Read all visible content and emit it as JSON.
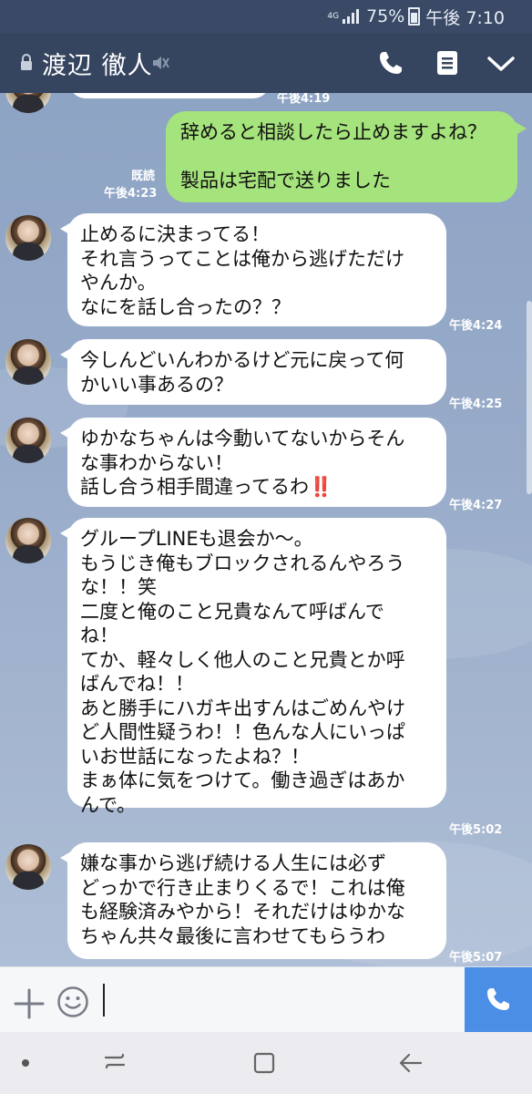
{
  "status_bar": {
    "network": "4G",
    "battery": "75%",
    "time": "午後 7:10"
  },
  "header": {
    "title": "渡辺 徹人",
    "icons": [
      "lock-icon",
      "mute-icon",
      "call-icon",
      "menu-icon",
      "chevron-down-icon"
    ]
  },
  "messages": {
    "partial_top_time": "午後4:19",
    "sent": {
      "text": "辞めると相談したら止めますよね？\n\n製品は宅配で送りました",
      "read": "既読",
      "time": "午後4:23"
    },
    "received": [
      {
        "text": "止めるに決まってる！\nそれ言うってことは俺から逃げただけ\nやんか。\nなにを話し合ったの？？",
        "time": "午後4:24"
      },
      {
        "text": "今しんどいんわかるけど元に戻って何\nかいい事あるの？",
        "time": "午後4:25"
      },
      {
        "text": "ゆかなちゃんは今動いてないからそん\nな事わからない！\n話し合う相手間違ってるわ‼️",
        "time": "午後4:27"
      },
      {
        "text": "グループLINEも退会か〜。\nもうじき俺もブロックされるんやろう\nな！！笑\n二度と俺のこと兄貴なんて呼ばんで\nね！\nてか、軽々しく他人のこと兄貴とか呼\nばんでね！！\nあと勝手にハガキ出すんはごめんやけ\nど人間性疑うわ！！色んな人にいっぱ\nいお世話になったよね？！\nまぁ体に気をつけて。働き過ぎはあか\nんで。",
        "time": "午後5:02"
      },
      {
        "text": "嫌な事から逃げ続ける人生には必ず\nどっかで行き止まりくるで！これは俺\nも経験済みやから！それだけはゆかな\nちゃん共々最後に言わせてもらうわ",
        "time": "午後5:07"
      }
    ]
  },
  "input_bar": {
    "icons": [
      "plus-icon",
      "emoji-icon",
      "phone-icon"
    ]
  },
  "nav_bar": {
    "icons": [
      "dot-icon",
      "recent-apps-icon",
      "home-icon",
      "back-icon"
    ]
  },
  "colors": {
    "header": "#35445f",
    "sent_bubble": "#a5e37c",
    "received_bubble": "#ffffff",
    "call_button": "#4a8ee5"
  }
}
